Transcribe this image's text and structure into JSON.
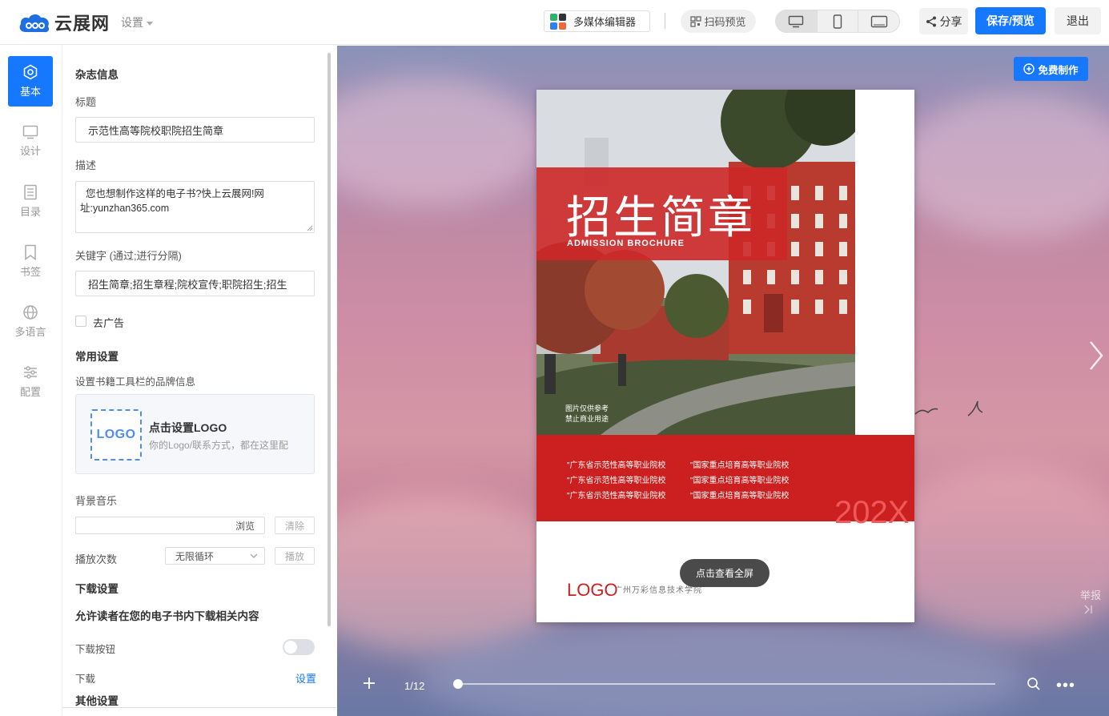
{
  "brand": {
    "name": "云展网"
  },
  "header": {
    "settings_label": "设置",
    "media_editor_label": "多媒体编辑器",
    "qr_preview_label": "扫码预览",
    "share_label": "分享",
    "save_label": "保存/预览",
    "exit_label": "退出"
  },
  "nav": {
    "items": [
      {
        "label": "基本",
        "icon": "settings-hex-icon",
        "active": true
      },
      {
        "label": "设计",
        "icon": "monitor-icon"
      },
      {
        "label": "目录",
        "icon": "list-doc-icon"
      },
      {
        "label": "书签",
        "icon": "bookmark-icon"
      },
      {
        "label": "多语言",
        "icon": "globe-icon"
      },
      {
        "label": "配置",
        "icon": "sliders-icon"
      }
    ]
  },
  "panel": {
    "magazine_info": "杂志信息",
    "title_label": "标题",
    "title_value": "示范性高等院校职院招生简章",
    "desc_label": "描述",
    "desc_line1": "您也想制作这样的电子书?快上云展网!网",
    "desc_line2": "址:yunzhan365.com",
    "keywords_label": "关键字 (通过;进行分隔)",
    "keywords_value": "招生简章;招生章程;院校宣传;职院招生;招生",
    "remove_ads_label": "去广告",
    "common_settings": "常用设置",
    "brand_info_label": "设置书籍工具栏的品牌信息",
    "logo_box_text": "LOGO",
    "logo_title": "点击设置LOGO",
    "logo_desc": "你的Logo/联系方式，都在这里配",
    "bg_music_label": "背景音乐",
    "browse_label": "浏览",
    "clear_label": "清除",
    "play_count_label": "播放次数",
    "loop_value": "无限循环",
    "play_label": "播放",
    "download_settings": "下载设置",
    "download_allow_text": "允许读者在您的电子书内下载相关内容",
    "download_button_label": "下载按钮",
    "download_label": "下载",
    "set_link": "设置",
    "other_settings": "其他设置"
  },
  "preview": {
    "free_make_label": "免费制作",
    "cover_title": "招生简章",
    "cover_subtitle": "ADMISSION  BROCHURE",
    "cover_items_left": [
      "\"广东省示范性高等职业院校",
      "\"广东省示范性高等职业院校",
      "\"广东省示范性高等职业院校"
    ],
    "cover_items_right": [
      "\"国家重点培育高等职业院校",
      "\"国家重点培育高等职业院校",
      "\"国家重点培育高等职业院校"
    ],
    "cover_year": "202X",
    "cover_logo": "LOGO",
    "cover_school": "广州万彩信息技术学院",
    "photo_caption_1": "图片仅供参考",
    "photo_caption_2": "禁止商业用途",
    "fullscreen_label": "点击查看全屏",
    "report_label": "举报",
    "page_indicator": "1/12",
    "page_progress": 0.0
  },
  "colors": {
    "accent": "#1677ff",
    "cover_red": "#cc2020"
  }
}
